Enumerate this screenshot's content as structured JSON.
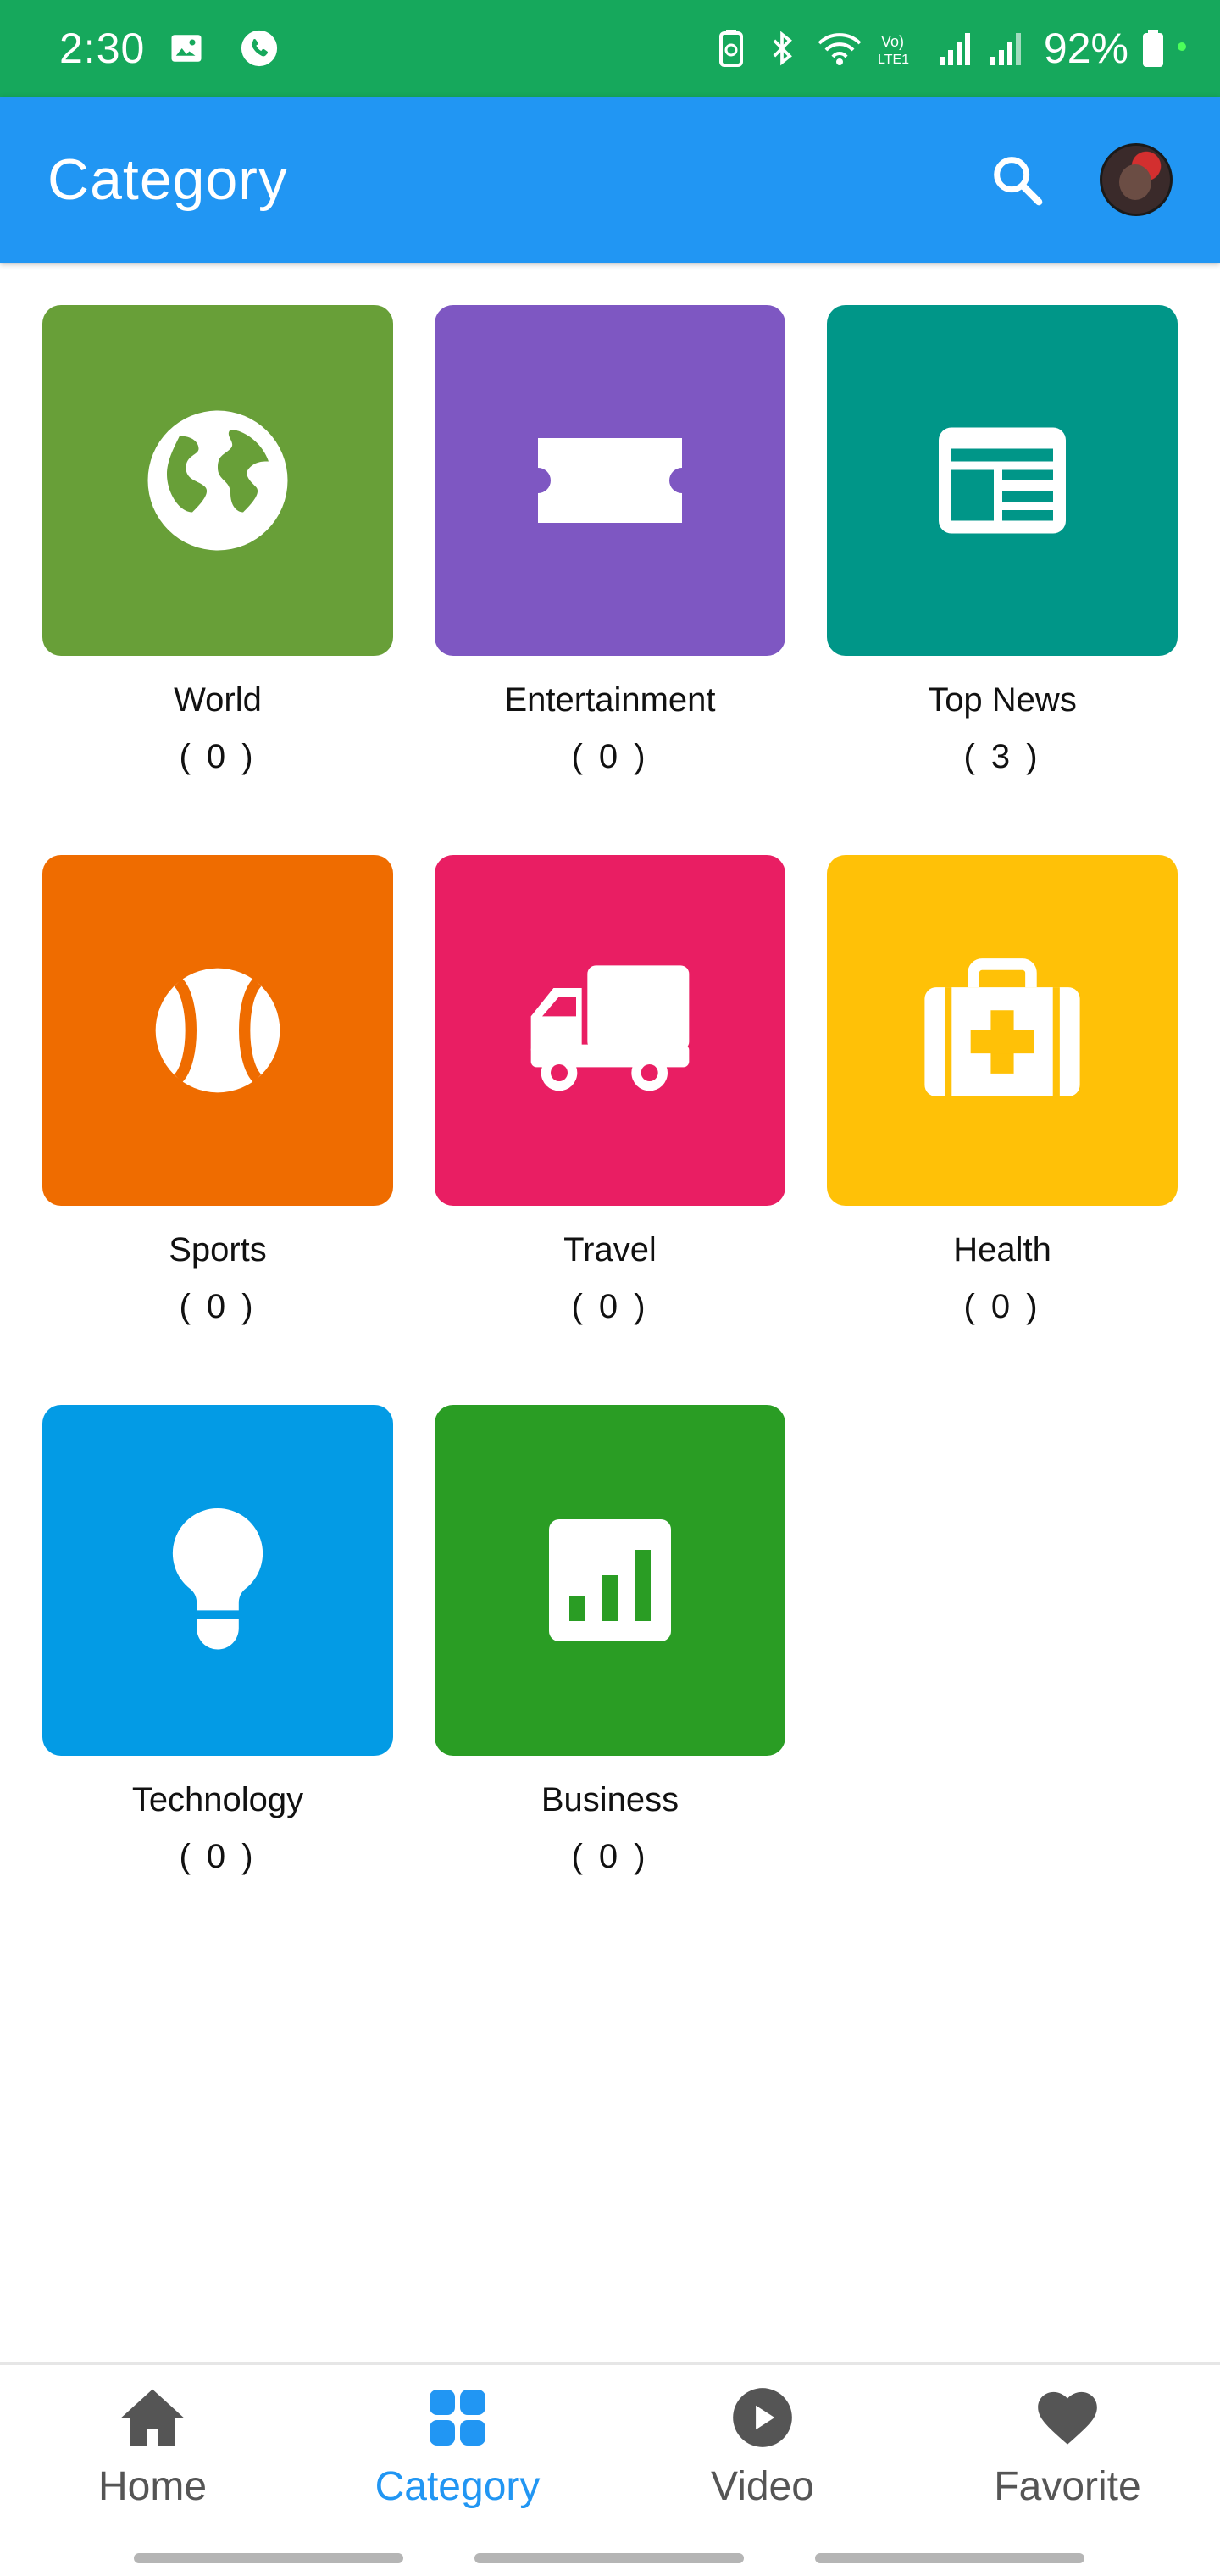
{
  "status_bar": {
    "time": "2:30",
    "battery": "92%",
    "icons": [
      "gallery-icon",
      "call-icon",
      "battery-saver-icon",
      "bluetooth-icon",
      "wifi-icon",
      "volte-icon",
      "signal-icon",
      "signal-icon-2",
      "battery-icon"
    ]
  },
  "app_bar": {
    "title": "Category",
    "color": "#2196f3",
    "actions": [
      "search-icon",
      "avatar"
    ]
  },
  "categories": [
    {
      "name": "World",
      "count": "( 0 )",
      "color": "#689f38",
      "icon": "globe-icon"
    },
    {
      "name": "Entertainment",
      "count": "( 0 )",
      "color": "#7e57c2",
      "icon": "ticket-icon"
    },
    {
      "name": "Top News",
      "count": "( 3 )",
      "color": "#009688",
      "icon": "newspaper-icon"
    },
    {
      "name": "Sports",
      "count": "( 0 )",
      "color": "#ef6c00",
      "icon": "baseball-icon"
    },
    {
      "name": "Travel",
      "count": "( 0 )",
      "color": "#e91e63",
      "icon": "truck-icon"
    },
    {
      "name": "Health",
      "count": "( 0 )",
      "color": "#ffc107",
      "icon": "medical-kit-icon"
    },
    {
      "name": "Technology",
      "count": "( 0 )",
      "color": "#039be5",
      "icon": "lightbulb-icon"
    },
    {
      "name": "Business",
      "count": "( 0 )",
      "color": "#2a9d24",
      "icon": "bar-chart-icon"
    }
  ],
  "bottom_nav": {
    "items": [
      {
        "label": "Home",
        "icon": "home-icon",
        "active": false
      },
      {
        "label": "Category",
        "icon": "grid-icon",
        "active": true
      },
      {
        "label": "Video",
        "icon": "play-circle-icon",
        "active": false
      },
      {
        "label": "Favorite",
        "icon": "heart-icon",
        "active": false
      }
    ],
    "active_color": "#2196f3",
    "inactive_color": "#555555"
  }
}
